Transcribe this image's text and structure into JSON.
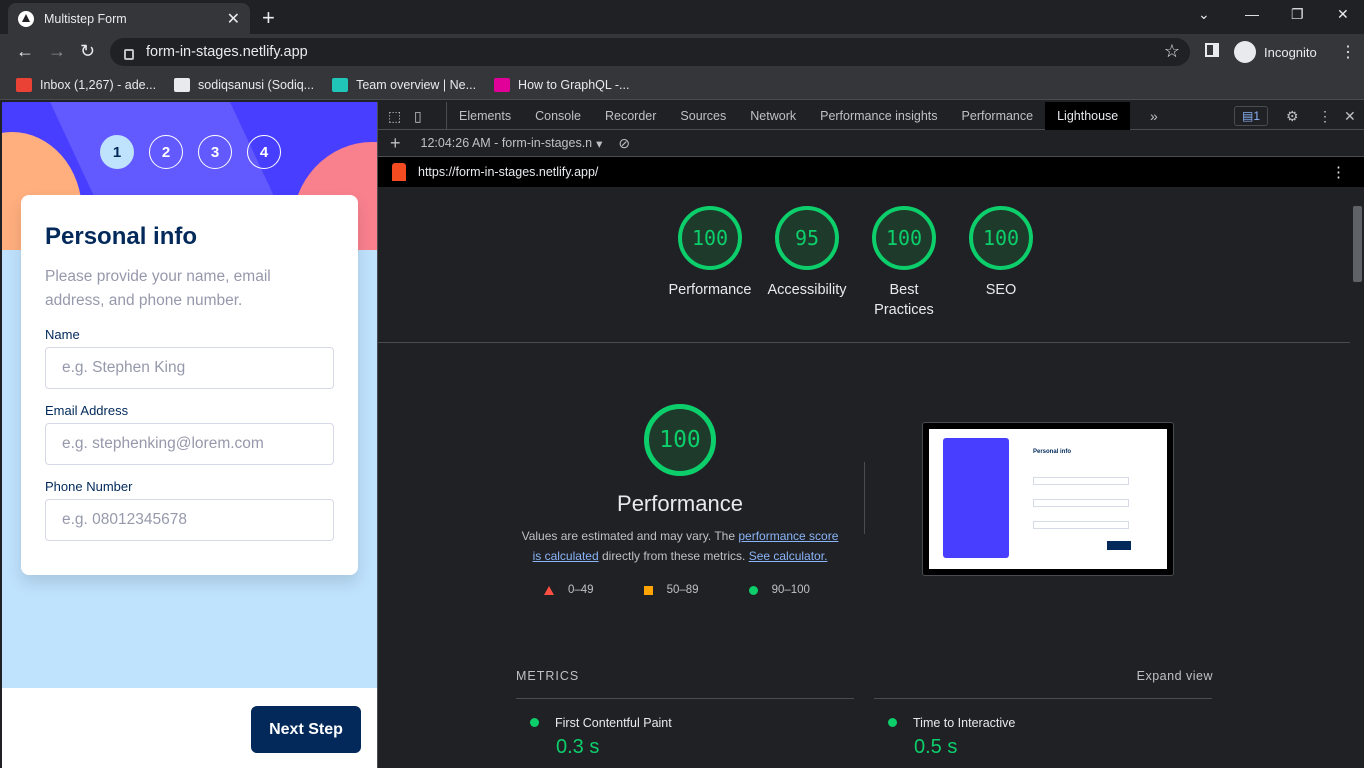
{
  "browser": {
    "tab_title": "Multistep Form",
    "url": "form-in-stages.netlify.app",
    "profile": "Incognito",
    "bookmarks": [
      {
        "label": "Inbox (1,267) - ade...",
        "icon": "gmail-icon",
        "color": "#ea4335"
      },
      {
        "label": "sodiqsanusi (Sodiq...",
        "icon": "github-icon",
        "color": "#e8eaed"
      },
      {
        "label": "Team overview | Ne...",
        "icon": "netlify-icon",
        "color": "#20c6b7"
      },
      {
        "label": "How to GraphQL -...",
        "icon": "graphql-icon",
        "color": "#e10098"
      }
    ]
  },
  "form": {
    "steps": [
      "1",
      "2",
      "3",
      "4"
    ],
    "title": "Personal info",
    "subtitle": "Please provide your name, email address, and phone number.",
    "fields": [
      {
        "label": "Name",
        "placeholder": "e.g. Stephen King"
      },
      {
        "label": "Email Address",
        "placeholder": "e.g. stephenking@lorem.com"
      },
      {
        "label": "Phone Number",
        "placeholder": "e.g. 08012345678"
      }
    ],
    "next_label": "Next Step"
  },
  "devtools": {
    "tabs": [
      "Elements",
      "Console",
      "Recorder",
      "Sources",
      "Network",
      "Performance insights",
      "Performance",
      "Lighthouse"
    ],
    "active_tab": "Lighthouse",
    "issues_count": "1",
    "report_time": "12:04:26 AM - form-in-stages.n",
    "report_url": "https://form-in-stages.netlify.app/"
  },
  "report": {
    "scores": [
      {
        "value": "100",
        "label": "Performance"
      },
      {
        "value": "95",
        "label": "Accessibility"
      },
      {
        "value": "100",
        "label": "Best Practices"
      },
      {
        "value": "100",
        "label": "SEO"
      }
    ],
    "perf_score": "100",
    "perf_title": "Performance",
    "desc_start": "Values are estimated and may vary. The ",
    "desc_link1": "performance score is calculated",
    "desc_mid": " directly from these metrics. ",
    "desc_link2": "See calculator.",
    "legend": [
      "0–49",
      "50–89",
      "90–100"
    ],
    "metrics_label": "METRICS",
    "expand_label": "Expand view",
    "metrics": [
      {
        "name": "First Contentful Paint",
        "value": "0.3 s"
      },
      {
        "name": "Time to Interactive",
        "value": "0.5 s"
      }
    ],
    "thumb_title": "Personal info"
  },
  "colors": {
    "pass": "#0cce6b",
    "average": "#ffa400",
    "fail": "#ff4e42",
    "marine": "#02295a",
    "purple": "#483eff"
  }
}
